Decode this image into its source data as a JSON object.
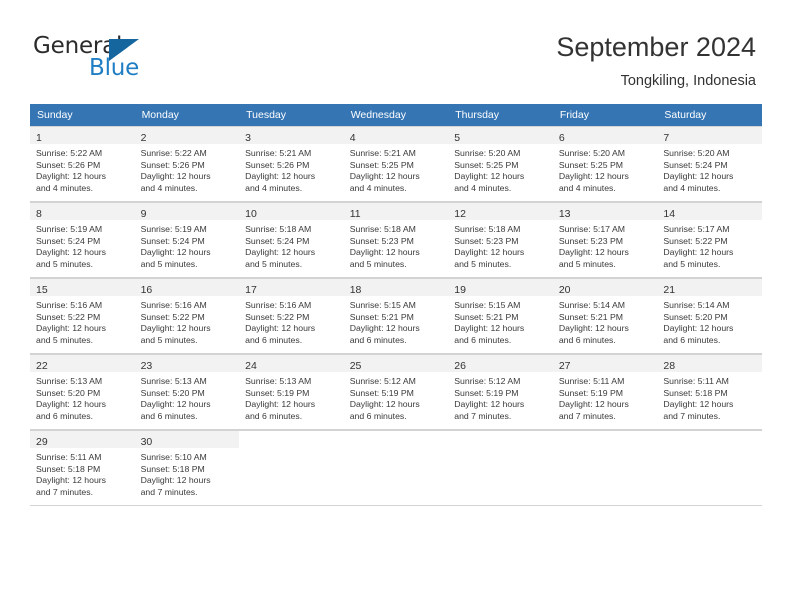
{
  "brand": {
    "name_part1": "General",
    "name_part2": "Blue",
    "flag_icon": "triangle-flag-icon"
  },
  "header": {
    "title": "September 2024",
    "subtitle": "Tongkiling, Indonesia"
  },
  "theme": {
    "header_blue": "#3575b4",
    "brand_blue": "#1f7ec4",
    "flag_blue": "#15659f",
    "daynum_bg": "#f2f2f2",
    "grid_line": "#d3d3d3",
    "text": "#333333"
  },
  "weekdays": [
    "Sunday",
    "Monday",
    "Tuesday",
    "Wednesday",
    "Thursday",
    "Friday",
    "Saturday"
  ],
  "labels": {
    "sunrise_prefix": "Sunrise:",
    "sunset_prefix": "Sunset:",
    "daylight_prefix": "Daylight:"
  },
  "weeks": [
    [
      {
        "day": "1",
        "sunrise": "Sunrise: 5:22 AM",
        "sunset": "Sunset: 5:26 PM",
        "daylight_line1": "Daylight: 12 hours",
        "daylight_line2": "and 4 minutes."
      },
      {
        "day": "2",
        "sunrise": "Sunrise: 5:22 AM",
        "sunset": "Sunset: 5:26 PM",
        "daylight_line1": "Daylight: 12 hours",
        "daylight_line2": "and 4 minutes."
      },
      {
        "day": "3",
        "sunrise": "Sunrise: 5:21 AM",
        "sunset": "Sunset: 5:26 PM",
        "daylight_line1": "Daylight: 12 hours",
        "daylight_line2": "and 4 minutes."
      },
      {
        "day": "4",
        "sunrise": "Sunrise: 5:21 AM",
        "sunset": "Sunset: 5:25 PM",
        "daylight_line1": "Daylight: 12 hours",
        "daylight_line2": "and 4 minutes."
      },
      {
        "day": "5",
        "sunrise": "Sunrise: 5:20 AM",
        "sunset": "Sunset: 5:25 PM",
        "daylight_line1": "Daylight: 12 hours",
        "daylight_line2": "and 4 minutes."
      },
      {
        "day": "6",
        "sunrise": "Sunrise: 5:20 AM",
        "sunset": "Sunset: 5:25 PM",
        "daylight_line1": "Daylight: 12 hours",
        "daylight_line2": "and 4 minutes."
      },
      {
        "day": "7",
        "sunrise": "Sunrise: 5:20 AM",
        "sunset": "Sunset: 5:24 PM",
        "daylight_line1": "Daylight: 12 hours",
        "daylight_line2": "and 4 minutes."
      }
    ],
    [
      {
        "day": "8",
        "sunrise": "Sunrise: 5:19 AM",
        "sunset": "Sunset: 5:24 PM",
        "daylight_line1": "Daylight: 12 hours",
        "daylight_line2": "and 5 minutes."
      },
      {
        "day": "9",
        "sunrise": "Sunrise: 5:19 AM",
        "sunset": "Sunset: 5:24 PM",
        "daylight_line1": "Daylight: 12 hours",
        "daylight_line2": "and 5 minutes."
      },
      {
        "day": "10",
        "sunrise": "Sunrise: 5:18 AM",
        "sunset": "Sunset: 5:24 PM",
        "daylight_line1": "Daylight: 12 hours",
        "daylight_line2": "and 5 minutes."
      },
      {
        "day": "11",
        "sunrise": "Sunrise: 5:18 AM",
        "sunset": "Sunset: 5:23 PM",
        "daylight_line1": "Daylight: 12 hours",
        "daylight_line2": "and 5 minutes."
      },
      {
        "day": "12",
        "sunrise": "Sunrise: 5:18 AM",
        "sunset": "Sunset: 5:23 PM",
        "daylight_line1": "Daylight: 12 hours",
        "daylight_line2": "and 5 minutes."
      },
      {
        "day": "13",
        "sunrise": "Sunrise: 5:17 AM",
        "sunset": "Sunset: 5:23 PM",
        "daylight_line1": "Daylight: 12 hours",
        "daylight_line2": "and 5 minutes."
      },
      {
        "day": "14",
        "sunrise": "Sunrise: 5:17 AM",
        "sunset": "Sunset: 5:22 PM",
        "daylight_line1": "Daylight: 12 hours",
        "daylight_line2": "and 5 minutes."
      }
    ],
    [
      {
        "day": "15",
        "sunrise": "Sunrise: 5:16 AM",
        "sunset": "Sunset: 5:22 PM",
        "daylight_line1": "Daylight: 12 hours",
        "daylight_line2": "and 5 minutes."
      },
      {
        "day": "16",
        "sunrise": "Sunrise: 5:16 AM",
        "sunset": "Sunset: 5:22 PM",
        "daylight_line1": "Daylight: 12 hours",
        "daylight_line2": "and 5 minutes."
      },
      {
        "day": "17",
        "sunrise": "Sunrise: 5:16 AM",
        "sunset": "Sunset: 5:22 PM",
        "daylight_line1": "Daylight: 12 hours",
        "daylight_line2": "and 6 minutes."
      },
      {
        "day": "18",
        "sunrise": "Sunrise: 5:15 AM",
        "sunset": "Sunset: 5:21 PM",
        "daylight_line1": "Daylight: 12 hours",
        "daylight_line2": "and 6 minutes."
      },
      {
        "day": "19",
        "sunrise": "Sunrise: 5:15 AM",
        "sunset": "Sunset: 5:21 PM",
        "daylight_line1": "Daylight: 12 hours",
        "daylight_line2": "and 6 minutes."
      },
      {
        "day": "20",
        "sunrise": "Sunrise: 5:14 AM",
        "sunset": "Sunset: 5:21 PM",
        "daylight_line1": "Daylight: 12 hours",
        "daylight_line2": "and 6 minutes."
      },
      {
        "day": "21",
        "sunrise": "Sunrise: 5:14 AM",
        "sunset": "Sunset: 5:20 PM",
        "daylight_line1": "Daylight: 12 hours",
        "daylight_line2": "and 6 minutes."
      }
    ],
    [
      {
        "day": "22",
        "sunrise": "Sunrise: 5:13 AM",
        "sunset": "Sunset: 5:20 PM",
        "daylight_line1": "Daylight: 12 hours",
        "daylight_line2": "and 6 minutes."
      },
      {
        "day": "23",
        "sunrise": "Sunrise: 5:13 AM",
        "sunset": "Sunset: 5:20 PM",
        "daylight_line1": "Daylight: 12 hours",
        "daylight_line2": "and 6 minutes."
      },
      {
        "day": "24",
        "sunrise": "Sunrise: 5:13 AM",
        "sunset": "Sunset: 5:19 PM",
        "daylight_line1": "Daylight: 12 hours",
        "daylight_line2": "and 6 minutes."
      },
      {
        "day": "25",
        "sunrise": "Sunrise: 5:12 AM",
        "sunset": "Sunset: 5:19 PM",
        "daylight_line1": "Daylight: 12 hours",
        "daylight_line2": "and 6 minutes."
      },
      {
        "day": "26",
        "sunrise": "Sunrise: 5:12 AM",
        "sunset": "Sunset: 5:19 PM",
        "daylight_line1": "Daylight: 12 hours",
        "daylight_line2": "and 7 minutes."
      },
      {
        "day": "27",
        "sunrise": "Sunrise: 5:11 AM",
        "sunset": "Sunset: 5:19 PM",
        "daylight_line1": "Daylight: 12 hours",
        "daylight_line2": "and 7 minutes."
      },
      {
        "day": "28",
        "sunrise": "Sunrise: 5:11 AM",
        "sunset": "Sunset: 5:18 PM",
        "daylight_line1": "Daylight: 12 hours",
        "daylight_line2": "and 7 minutes."
      }
    ],
    [
      {
        "day": "29",
        "sunrise": "Sunrise: 5:11 AM",
        "sunset": "Sunset: 5:18 PM",
        "daylight_line1": "Daylight: 12 hours",
        "daylight_line2": "and 7 minutes."
      },
      {
        "day": "30",
        "sunrise": "Sunrise: 5:10 AM",
        "sunset": "Sunset: 5:18 PM",
        "daylight_line1": "Daylight: 12 hours",
        "daylight_line2": "and 7 minutes."
      },
      {
        "day": "",
        "sunrise": "",
        "sunset": "",
        "daylight_line1": "",
        "daylight_line2": ""
      },
      {
        "day": "",
        "sunrise": "",
        "sunset": "",
        "daylight_line1": "",
        "daylight_line2": ""
      },
      {
        "day": "",
        "sunrise": "",
        "sunset": "",
        "daylight_line1": "",
        "daylight_line2": ""
      },
      {
        "day": "",
        "sunrise": "",
        "sunset": "",
        "daylight_line1": "",
        "daylight_line2": ""
      },
      {
        "day": "",
        "sunrise": "",
        "sunset": "",
        "daylight_line1": "",
        "daylight_line2": ""
      }
    ]
  ]
}
